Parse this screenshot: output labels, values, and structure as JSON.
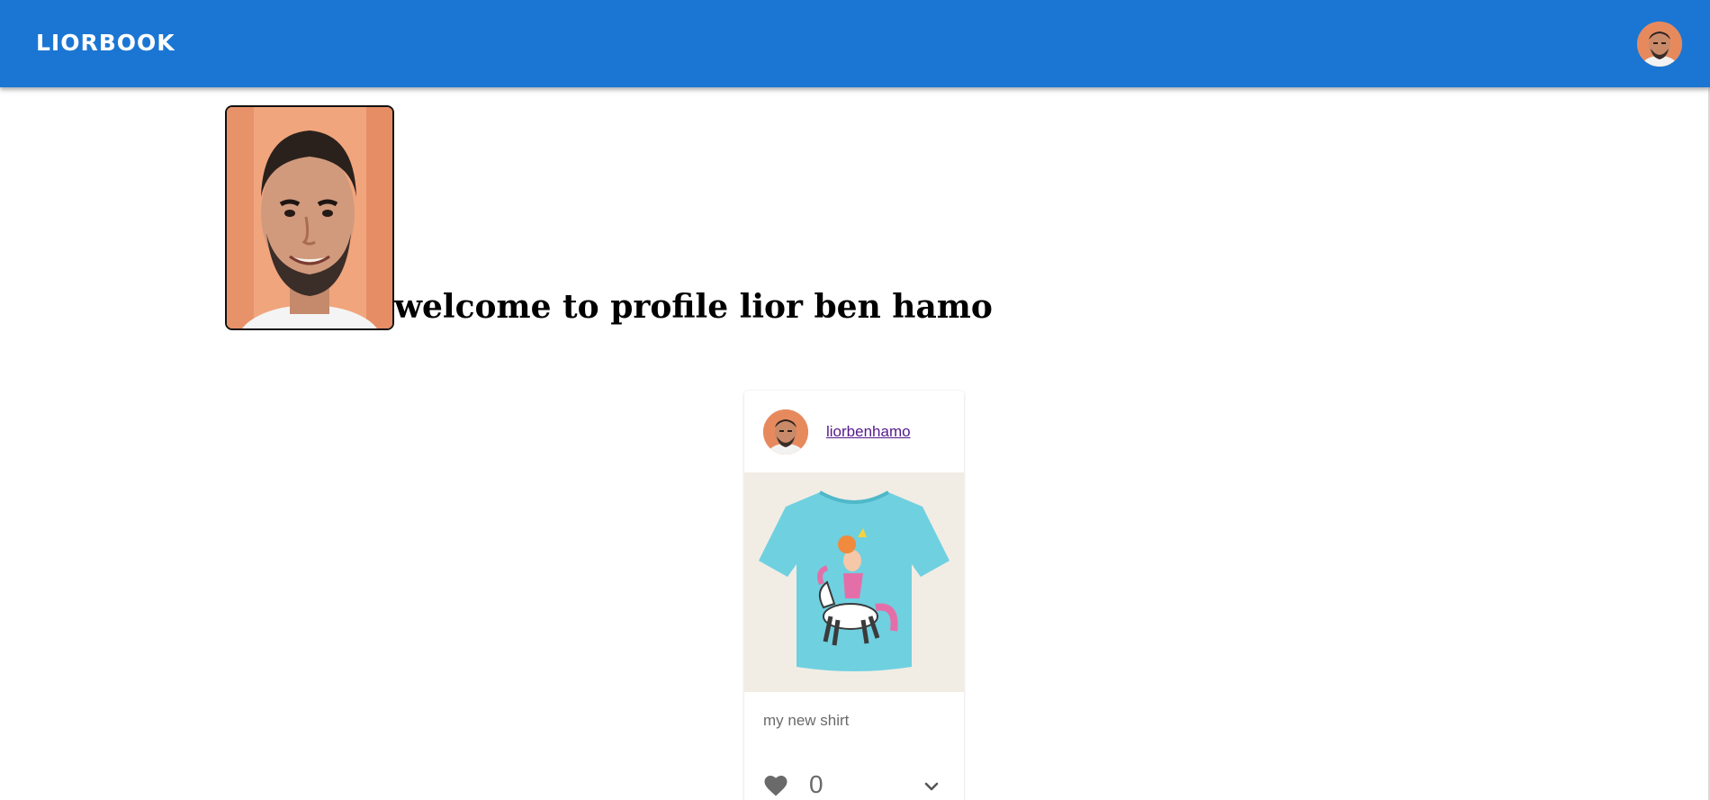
{
  "appbar": {
    "brand": "LIORBOOK",
    "color": "#1b76d3",
    "avatar_icon": "user-avatar-icon"
  },
  "profile": {
    "welcome_text": "welcome to profile lior ben hamo"
  },
  "post": {
    "username": "liorbenhamo",
    "caption": "my new shirt",
    "likes": "0",
    "like_icon": "heart-icon",
    "expand_icon": "chevron-down-icon",
    "image_description_icon": "shirt-image"
  }
}
